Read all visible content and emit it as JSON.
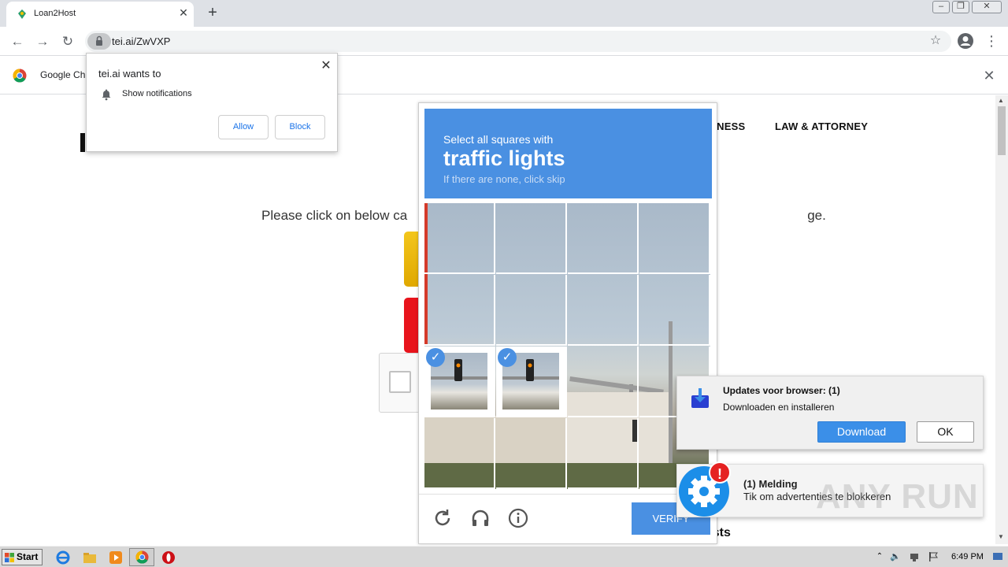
{
  "browser": {
    "tab": {
      "title": "Loan2Host",
      "close_icon": "close-icon"
    },
    "new_tab_label": "+",
    "url": "tei.ai/ZwVXP",
    "infobar_text": "Google Ch"
  },
  "permission_prompt": {
    "title": "tei.ai wants to",
    "item": "Show notifications",
    "allow_label": "Allow",
    "block_label": "Block"
  },
  "site": {
    "nav": [
      "TNESS",
      "LAW & ATTORNEY"
    ],
    "message_left": "Please click on below ca",
    "message_right": "ge.",
    "posts_text": "osts"
  },
  "captcha": {
    "prompt": "Select all squares with",
    "target": "traffic lights",
    "skip_hint": "If there are none, click skip",
    "selected_cells": [
      8,
      9
    ],
    "verify_label": "VERIFY",
    "colors": {
      "accent": "#4a90e2"
    }
  },
  "update_toast": {
    "title": "Updates voor browser: (1)",
    "subtitle": "Downloaden en installeren",
    "download_label": "Download",
    "ok_label": "OK"
  },
  "melding_toast": {
    "badge": "!",
    "title": "(1) Melding",
    "subtitle": "Tik om advertenties te blokkeren"
  },
  "watermark": "ANY RUN",
  "taskbar": {
    "start_label": "Start",
    "clock": "6:49 PM"
  }
}
